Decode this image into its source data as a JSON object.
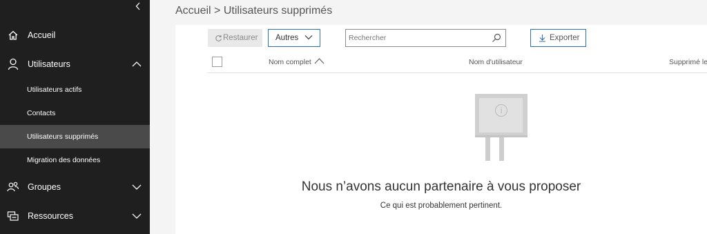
{
  "sidebar": {
    "items": [
      {
        "label": "Accueil",
        "icon": "home-icon"
      },
      {
        "label": "Utilisateurs",
        "icon": "person-icon",
        "expanded": true,
        "children": [
          {
            "label": "Utilisateurs actifs"
          },
          {
            "label": "Contacts"
          },
          {
            "label": "Utilisateurs supprimés",
            "active": true
          },
          {
            "label": "Migration des données"
          }
        ]
      },
      {
        "label": "Groupes",
        "icon": "group-icon"
      },
      {
        "label": "Ressources",
        "icon": "resources-icon"
      }
    ]
  },
  "breadcrumb": "Accueil > Utilisateurs supprimés",
  "toolbar": {
    "restore_label": "Restaurer",
    "autres_label": "Autres",
    "search_placeholder": "Rechercher",
    "export_label": "Exporter"
  },
  "table": {
    "columns": [
      "Nom complet",
      "Nom d'utilisateur",
      "Supprimé le"
    ]
  },
  "empty": {
    "title": "Nous n’avons aucun partenaire à vous proposer",
    "subtitle": "Ce qui est probablement pertinent."
  },
  "colors": {
    "sidebar_bg": "#1f1f1f",
    "active_item_bg": "#4a4a4a",
    "accent": "#2d6fb7"
  }
}
